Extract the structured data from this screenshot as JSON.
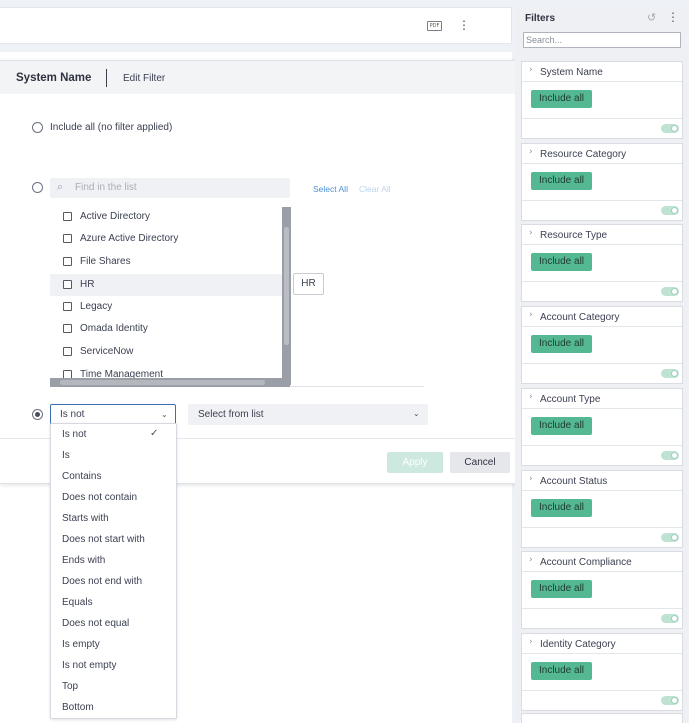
{
  "dialog": {
    "title": "System Name",
    "subtitle": "Edit Filter",
    "include_all_label": "Include all (no filter applied)",
    "search_placeholder": "Find in the list",
    "select_all": "Select All",
    "clear_all": "Clear All",
    "list_items": [
      {
        "label": "Active Directory",
        "checked": false
      },
      {
        "label": "Azure Active Directory",
        "checked": false
      },
      {
        "label": "File Shares",
        "checked": false
      },
      {
        "label": "HR",
        "checked": false,
        "hovered": true
      },
      {
        "label": "Legacy",
        "checked": false
      },
      {
        "label": "Omada Identity",
        "checked": false
      },
      {
        "label": "ServiceNow",
        "checked": false
      },
      {
        "label": "Time Management",
        "checked": false
      }
    ],
    "tooltip": "HR",
    "operator_selected": "Is not",
    "value_placeholder": "Select from list",
    "apply_label": "Apply",
    "cancel_label": "Cancel"
  },
  "operator_menu": [
    {
      "label": "Is not",
      "selected": true
    },
    {
      "label": "Is"
    },
    {
      "label": "Contains"
    },
    {
      "label": "Does not contain"
    },
    {
      "label": "Starts with"
    },
    {
      "label": "Does not start with"
    },
    {
      "label": "Ends with"
    },
    {
      "label": "Does not end with"
    },
    {
      "label": "Equals"
    },
    {
      "label": "Does not equal"
    },
    {
      "label": "Is empty"
    },
    {
      "label": "Is not empty"
    },
    {
      "label": "Top"
    },
    {
      "label": "Bottom"
    }
  ],
  "report_toolbar": {
    "pdf_label": "PDF"
  },
  "filters_panel": {
    "title": "Filters",
    "search_placeholder": "Search...",
    "cards": [
      {
        "name": "System Name",
        "value": "Include all"
      },
      {
        "name": "Resource Category",
        "value": "Include all"
      },
      {
        "name": "Resource Type",
        "value": "Include all"
      },
      {
        "name": "Account Category",
        "value": "Include all"
      },
      {
        "name": "Account Type",
        "value": "Include all"
      },
      {
        "name": "Account Status",
        "value": "Include all"
      },
      {
        "name": "Account Compliance",
        "value": "Include all"
      },
      {
        "name": "Identity Category",
        "value": "Include all"
      }
    ]
  },
  "colors": {
    "accent_green": "#54b993",
    "link_blue": "#4d8fd8",
    "select_border": "#3f6fb2"
  }
}
